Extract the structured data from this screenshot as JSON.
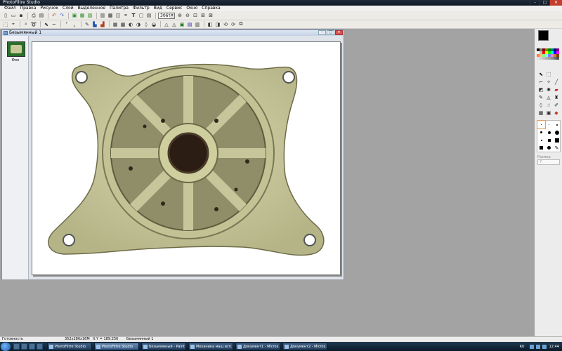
{
  "app": {
    "title": "PhotoFiltre Studio"
  },
  "menu": [
    "Файл",
    "Правка",
    "Рисунок",
    "Слой",
    "Выделенное",
    "Палитра",
    "Фильтр",
    "Вид",
    "Сервис",
    "Окно",
    "Справка"
  ],
  "toolbar": {
    "zoom_value": "306%"
  },
  "document": {
    "title": "Безымянный 1",
    "layer_label": "Фон"
  },
  "right_panel": {
    "options_label": "Размер",
    "options_value": "7"
  },
  "status": {
    "state": "Готовность",
    "size": "352x286x16M",
    "coords": "X:Y = 189:256",
    "doc_name": "Безымянный 1"
  },
  "taskbar": {
    "tasks": [
      "PhotoFiltre Studio",
      "PhotoFiltre Studio",
      "Безымянный - Paint",
      "Механика маш.исп...",
      "Документ1 - Micros...",
      "Документ2 - Micros..."
    ],
    "language": "RU",
    "clock": "12:44"
  },
  "colors": {
    "foreground": "#000000",
    "background": "#ffffff",
    "part_fill": "#c9c89a"
  }
}
